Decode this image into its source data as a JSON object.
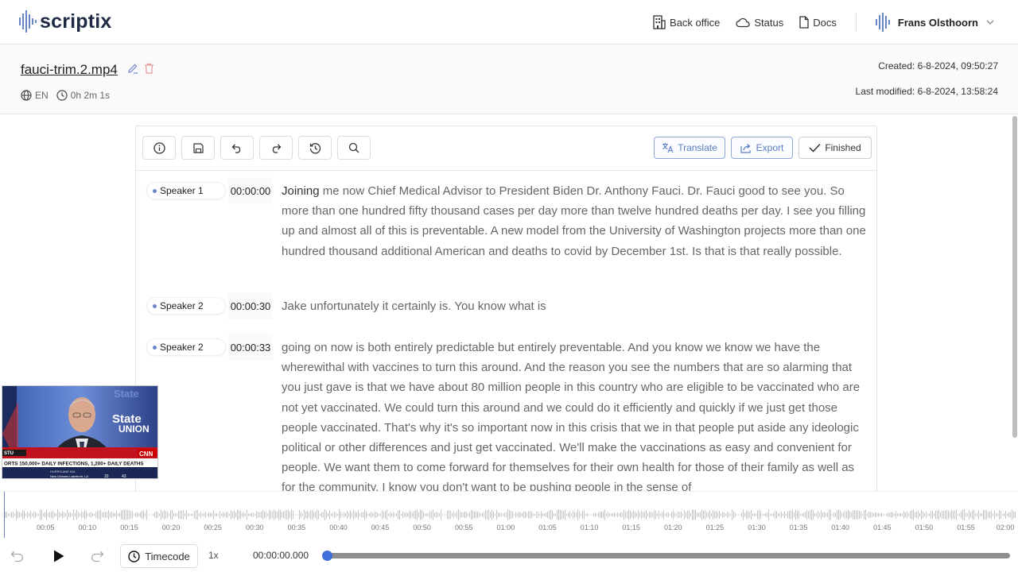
{
  "app": {
    "logo_text": "scriptix"
  },
  "nav": {
    "back_office": "Back office",
    "status": "Status",
    "docs": "Docs",
    "user_name": "Frans Olsthoorn"
  },
  "file": {
    "name": "fauci-trim.2.mp4",
    "language": "EN",
    "duration": "0h 2m 1s",
    "created": "Created: 6-8-2024, 09:50:27",
    "last_modified": "Last modified: 6-8-2024, 13:58:24"
  },
  "toolbar": {
    "icons": [
      "info-icon",
      "save-icon",
      "undo-icon",
      "redo-icon",
      "history-icon",
      "search-icon"
    ],
    "translate_label": "Translate",
    "export_label": "Export",
    "finished_label": "Finished"
  },
  "segments": [
    {
      "speaker": "Speaker 1",
      "timestamp": "00:00:00",
      "first_word": "Joining",
      "text": " me now Chief Medical Advisor to President Biden Dr. Anthony Fauci. Dr. Fauci good to see you. So more than one hundred fifty thousand cases per day more than twelve hundred deaths per day. I see you filling up and almost all of this is preventable. A new model from the University of Washington projects more than one hundred thousand additional American and deaths to covid by December 1st. Is that is that really possible."
    },
    {
      "speaker": "Speaker 2",
      "timestamp": "00:00:30",
      "first_word": "",
      "text": " Jake unfortunately it certainly is. You know what is"
    },
    {
      "speaker": "Speaker 2",
      "timestamp": "00:00:33",
      "first_word": "",
      "text": "going on now is both entirely predictable but entirely preventable. And you know we know we have the wherewithal with vaccines to turn this around. And the reason you see the numbers that are so alarming that you just gave is that we have about 80 million people in this country who are eligible to be vaccinated who are not yet vaccinated. We could turn this around and we could do it efficiently and quickly if we just get those people vaccinated. That's why it's so important now in this crisis that we in that people put aside any ideologic political or other differences and just get vaccinated. We'll make the vaccinations as easy and convenient for people. We want them to come forward for themselves for their own health for those of their family as well as for the community. I know you don't want to be pushing people in the sense of"
    }
  ],
  "video": {
    "show_label": "State of the UNION",
    "network": "CNN",
    "ticker": "ORTS 150,000+ DAILY INFECTIONS, 1,200+ DAILY DEATHS",
    "ticker_sub": "HURRICANE IDA",
    "ticker_loc": "New Orleans Lakefront, LA",
    "temp1": "33",
    "temp2": "43",
    "stu": "STU"
  },
  "waveform": {
    "ticks": [
      "00:05",
      "00:10",
      "00:15",
      "00:20",
      "00:25",
      "00:30",
      "00:35",
      "00:40",
      "00:45",
      "00:50",
      "00:55",
      "01:00",
      "01:05",
      "01:10",
      "01:15",
      "01:20",
      "01:25",
      "01:30",
      "01:35",
      "01:40",
      "01:45",
      "01:50",
      "01:55",
      "02:00"
    ]
  },
  "player": {
    "timecode_label": "Timecode",
    "speed": "1x",
    "current_time": "00:00:00.000",
    "progress": 0.0
  },
  "colors": {
    "accent": "#3f6fd8",
    "speaker_dot": "#6b86c7",
    "action_blue": "#5a7ec2"
  }
}
